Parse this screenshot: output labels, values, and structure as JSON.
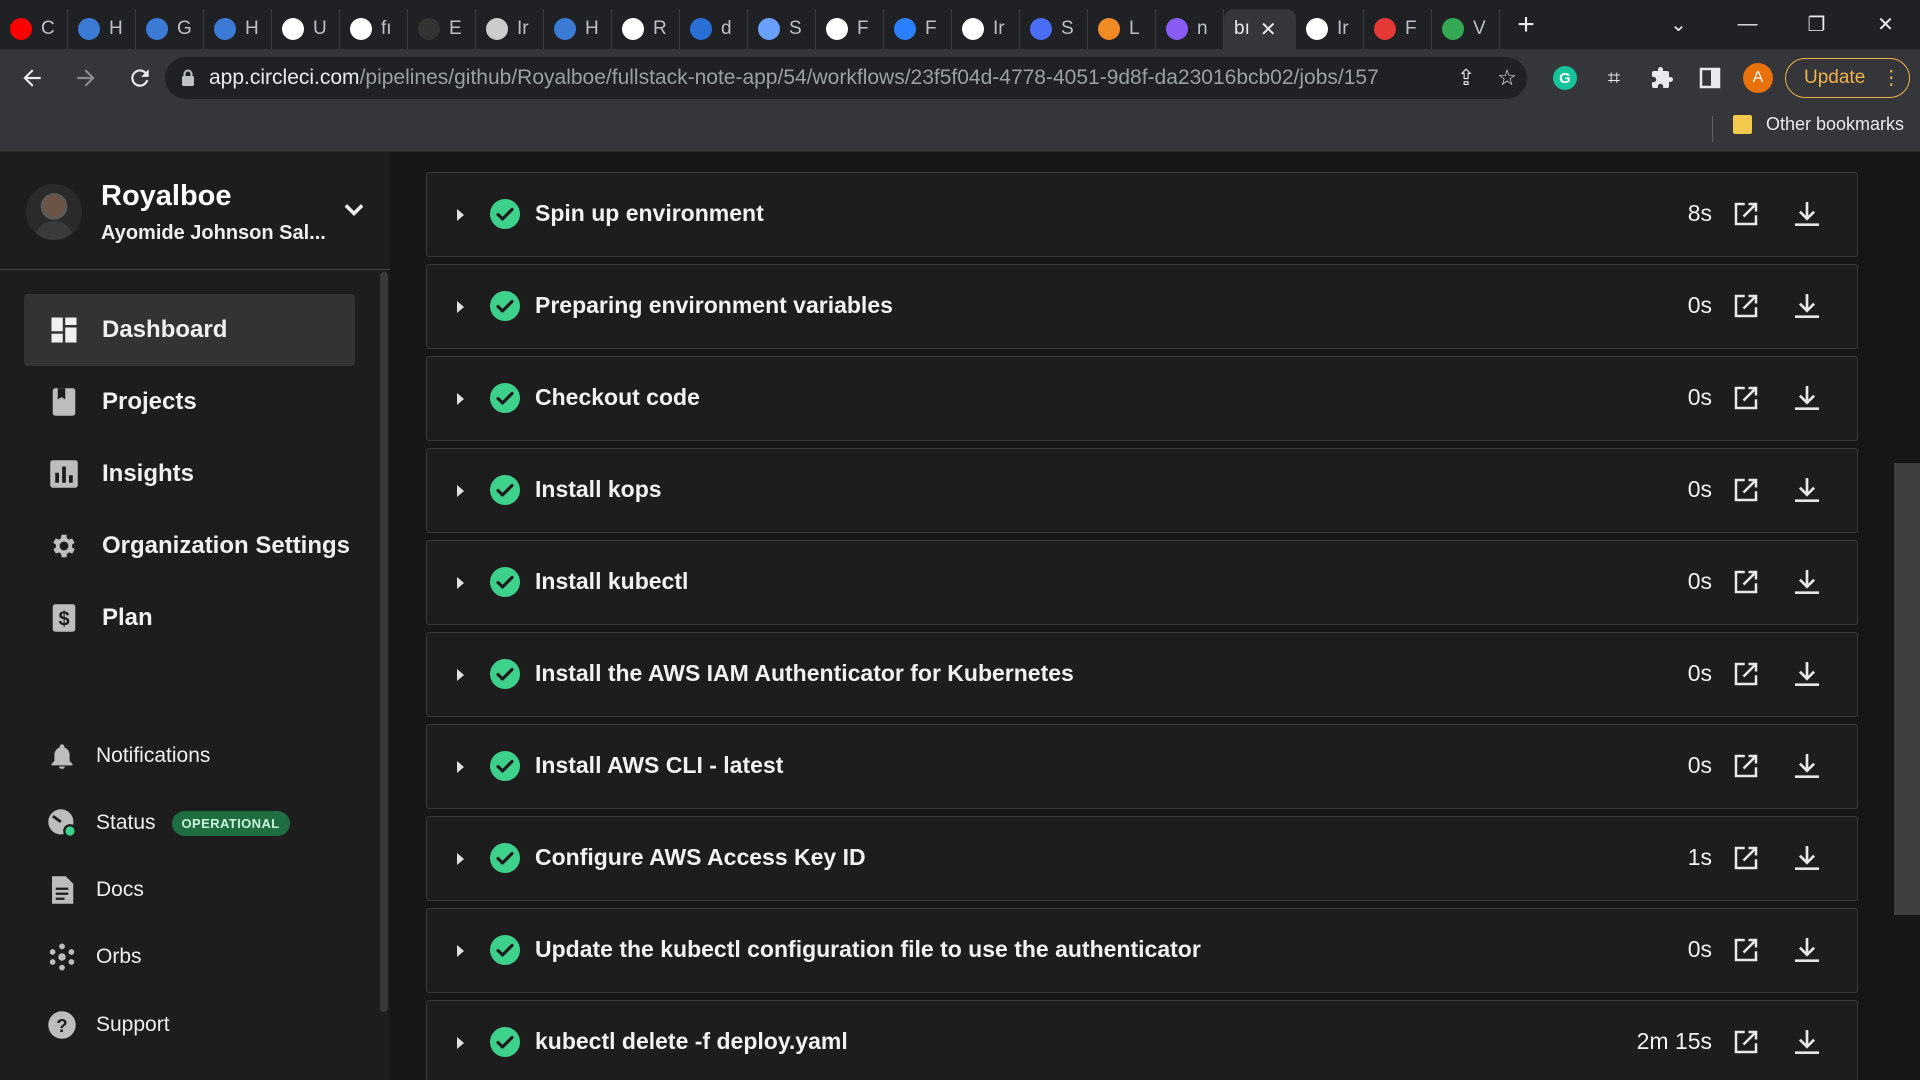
{
  "browser": {
    "tabs": [
      {
        "title": "C",
        "color": "#ff0000"
      },
      {
        "title": "H",
        "color": "#3b7bd6"
      },
      {
        "title": "G",
        "color": "#3b7bd6"
      },
      {
        "title": "H",
        "color": "#3b7bd6"
      },
      {
        "title": "U",
        "color": "#ffffff"
      },
      {
        "title": "fı",
        "color": "#ffffff"
      },
      {
        "title": "E",
        "color": "#333333"
      },
      {
        "title": "Ir",
        "color": "#cccccc"
      },
      {
        "title": "H",
        "color": "#3b7bd6"
      },
      {
        "title": "R",
        "color": "#ffffff"
      },
      {
        "title": "d",
        "color": "#2a6fd6"
      },
      {
        "title": "S",
        "color": "#6aa0ff"
      },
      {
        "title": "F",
        "color": "#ffffff"
      },
      {
        "title": "F",
        "color": "#2a80ff"
      },
      {
        "title": "Ir",
        "color": "#ffffff"
      },
      {
        "title": "S",
        "color": "#4a6ef5"
      },
      {
        "title": "L",
        "color": "#f08a24"
      },
      {
        "title": "n",
        "color": "#8a5cf5"
      }
    ],
    "active_tab": {
      "title": "bı",
      "close": "✕"
    },
    "tabs_after": [
      {
        "title": "Ir",
        "color": "#ffffff"
      },
      {
        "title": "F",
        "color": "#e53935"
      },
      {
        "title": "V",
        "color": "#34a853"
      }
    ],
    "new_tab": "+",
    "url_host": "app.circleci.com",
    "url_path": "/pipelines/github/Royalboe/fullstack-note-app/54/workflows/23f5f04d-4778-4051-9d8f-da23016bcb02/jobs/157",
    "profile_initial": "A",
    "update_label": "Update",
    "bookmarks_other": "Other bookmarks"
  },
  "sidebar": {
    "account_name": "Royalboe",
    "account_sub": "Ayomide Johnson Sal...",
    "primary": [
      {
        "label": "Dashboard",
        "icon": "dashboard-icon",
        "active": true
      },
      {
        "label": "Projects",
        "icon": "projects-icon"
      },
      {
        "label": "Insights",
        "icon": "insights-icon"
      },
      {
        "label": "Organization Settings",
        "icon": "gear-icon"
      },
      {
        "label": "Plan",
        "icon": "dollar-icon"
      }
    ],
    "secondary": [
      {
        "label": "Notifications",
        "icon": "bell-icon"
      },
      {
        "label": "Status",
        "icon": "status-icon",
        "badge": "OPERATIONAL"
      },
      {
        "label": "Docs",
        "icon": "docs-icon"
      },
      {
        "label": "Orbs",
        "icon": "orbs-icon"
      },
      {
        "label": "Support",
        "icon": "help-icon"
      }
    ]
  },
  "steps": [
    {
      "name": "Spin up environment",
      "duration": "8s"
    },
    {
      "name": "Preparing environment variables",
      "duration": "0s"
    },
    {
      "name": "Checkout code",
      "duration": "0s"
    },
    {
      "name": "Install kops",
      "duration": "0s"
    },
    {
      "name": "Install kubectl",
      "duration": "0s"
    },
    {
      "name": "Install the AWS IAM Authenticator for Kubernetes",
      "duration": "0s"
    },
    {
      "name": "Install AWS CLI - latest",
      "duration": "0s"
    },
    {
      "name": "Configure AWS Access Key ID",
      "duration": "1s"
    },
    {
      "name": "Update the kubectl configuration file to use the authenticator",
      "duration": "0s"
    },
    {
      "name": "kubectl delete -f deploy.yaml",
      "duration": "2m 15s"
    }
  ],
  "colors": {
    "success": "#3ed18c",
    "badge_bg": "#1f6e42"
  }
}
